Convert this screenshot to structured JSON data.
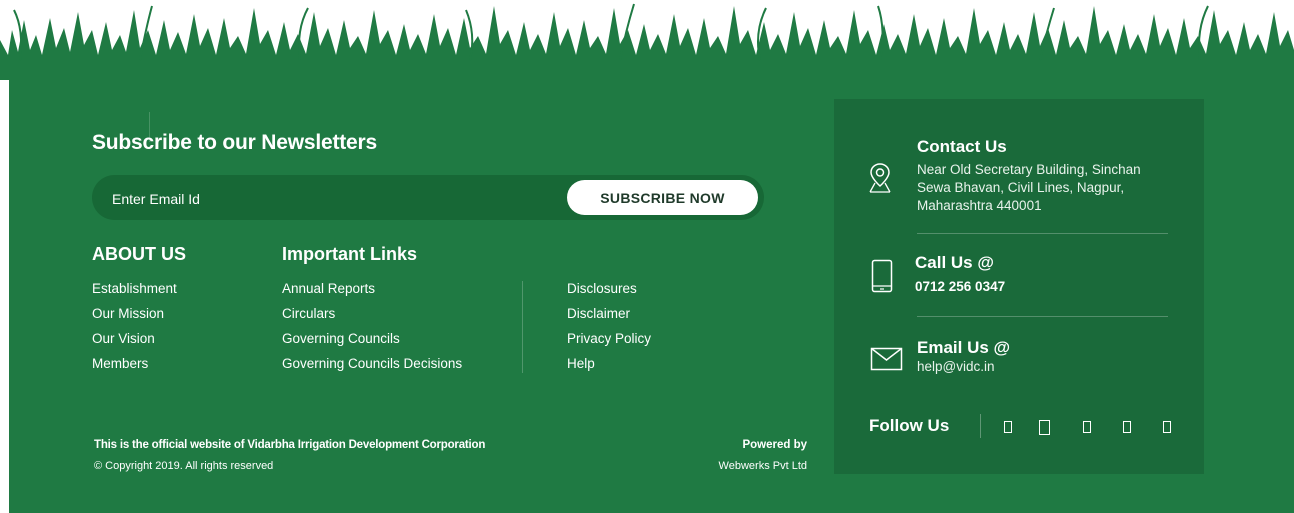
{
  "newsletter": {
    "title": "Subscribe to our Newsletters",
    "placeholder": "Enter Email Id",
    "button": "SUBSCRIBE NOW"
  },
  "about": {
    "title": "ABOUT US",
    "items": [
      "Establishment",
      "Our Mission",
      "Our Vision",
      "Members"
    ]
  },
  "important": {
    "title": "Important Links",
    "col1": [
      "Annual Reports",
      "Circulars",
      "Governing Councils",
      "Governing Councils Decisions"
    ],
    "col2": [
      "Disclosures",
      "Disclaimer",
      "Privacy Policy",
      "Help"
    ]
  },
  "bottom": {
    "official": "This is the official website of Vidarbha Irrigation Development Corporation",
    "copyright": "© Copyright 2019. All rights reserved",
    "powered_label": "Powered by",
    "powered_by": "Webwerks Pvt Ltd"
  },
  "contact": {
    "title": "Contact Us",
    "address_line1": "Near Old Secretary Building, Sinchan",
    "address_line2": "Sewa Bhavan, Civil Lines, Nagpur,",
    "address_line3": "Maharashtra 440001",
    "call_title": "Call Us @",
    "phone": "0712 256 0347",
    "email_title": "Email Us @",
    "email": "help@vidc.in",
    "follow": "Follow Us",
    "social_icons": [
      "facebook-icon",
      "twitter-icon",
      "instagram-icon",
      "linkedin-icon",
      "youtube-icon"
    ]
  },
  "colors": {
    "footer_green": "#1f7a43",
    "panel_green": "#1a6a3a",
    "input_green": "#176836"
  }
}
